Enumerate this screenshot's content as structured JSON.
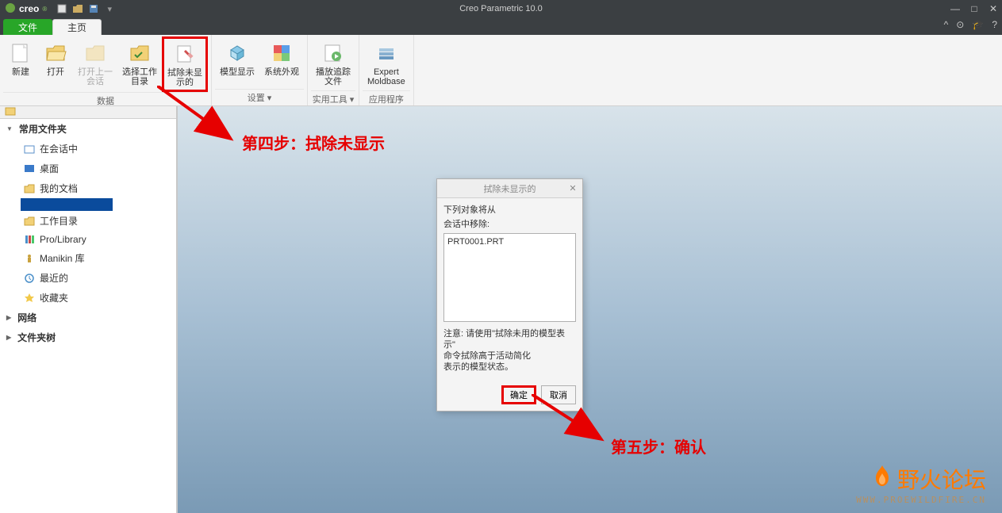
{
  "titlebar": {
    "logo": "creo",
    "app_title": "Creo Parametric 10.0"
  },
  "tabs": {
    "file": "文件",
    "home": "主页"
  },
  "ribbon": {
    "data_group": "数据",
    "settings_group": "设置",
    "tools_group": "实用工具",
    "apps_group": "应用程序",
    "new": "新建",
    "open": "打开",
    "open_last": "打开上一\n会话",
    "select_wd": "选择工作\n目录",
    "erase_not_disp": "拭除未显\n示的",
    "model_disp": "模型显示",
    "sys_appear": "系统外观",
    "play_trail": "播放追踪\n文件",
    "expert_mold": "Expert\nMoldbase"
  },
  "sidebar": {
    "common_folders": "常用文件夹",
    "in_session": "在会话中",
    "desktop": "桌面",
    "my_docs": "我的文档",
    "working_dir": "工作目录",
    "pro_library": "Pro/Library",
    "manikin": "Manikin 库",
    "recent": "最近的",
    "favorites": "收藏夹",
    "network": "网络",
    "folder_tree": "文件夹树"
  },
  "dialog": {
    "title": "拭除未显示的",
    "desc1": "下列对象将从",
    "desc2": "会话中移除:",
    "item": "PRT0001.PRT",
    "note1": "注意: 请使用\"拭除未用的模型表示\"",
    "note2": "命令拭除高于活动简化",
    "note3": "表示的模型状态。",
    "ok": "确定",
    "cancel": "取消"
  },
  "annotations": {
    "step4": "第四步：拭除未显示",
    "step5": "第五步：确认"
  },
  "watermark": {
    "text": "野火论坛",
    "url": "WWW.PROEWILDFIRE.CN"
  }
}
